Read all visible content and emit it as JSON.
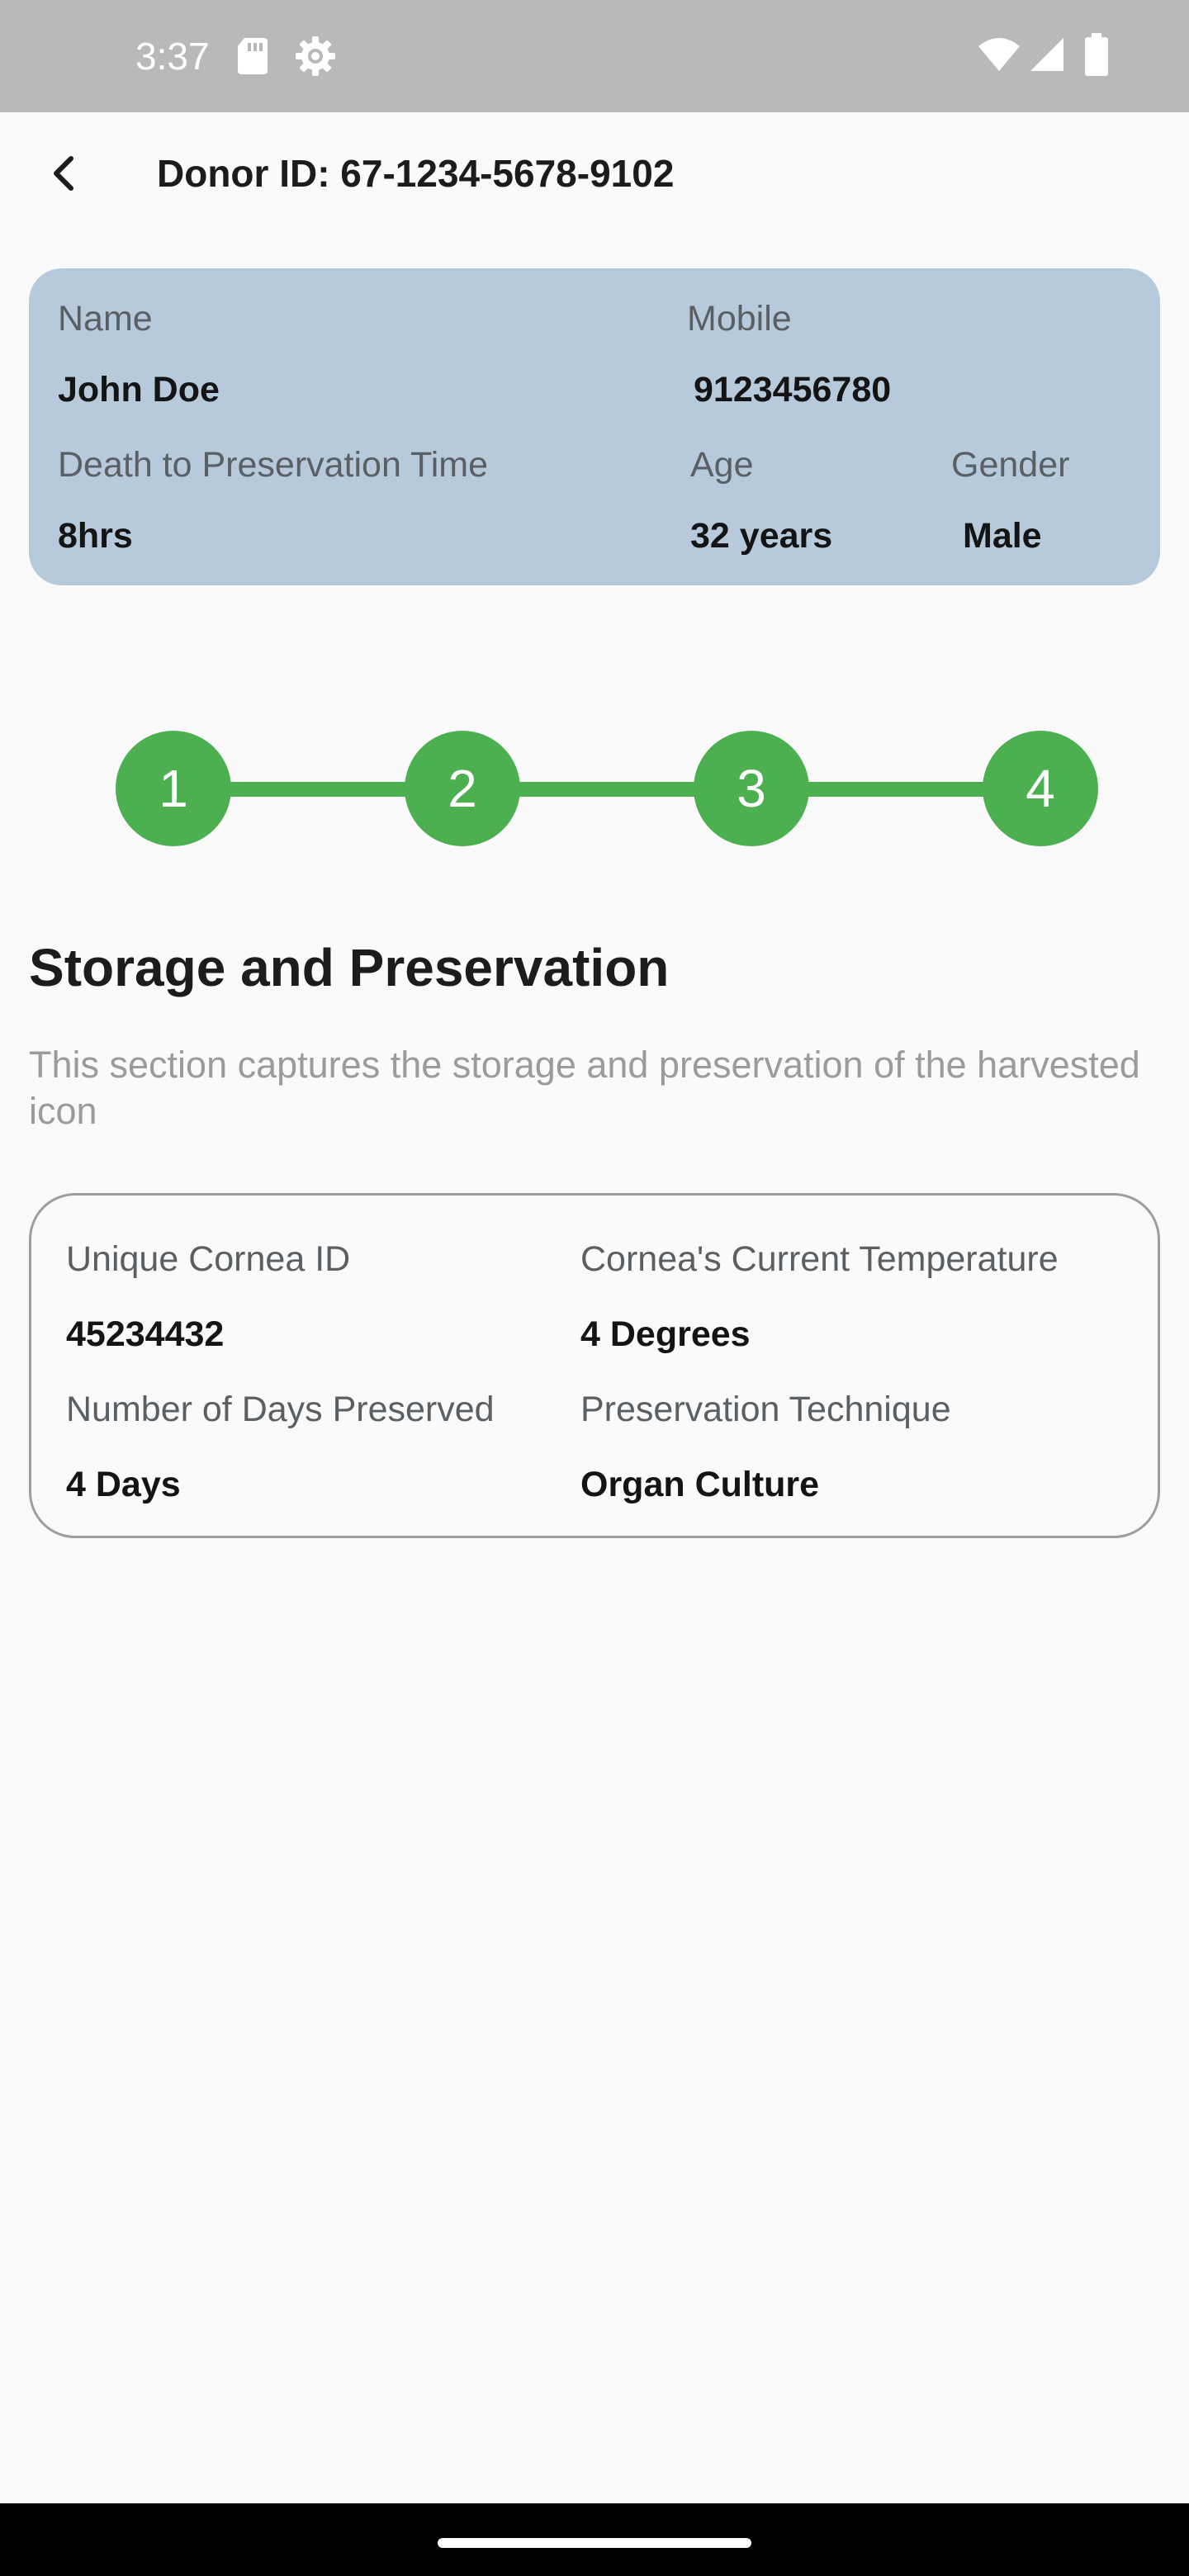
{
  "status_bar": {
    "time": "3:37",
    "icons": [
      "sd-card-icon",
      "settings-gear-icon",
      "wifi-icon",
      "signal-icon",
      "battery-icon"
    ]
  },
  "app_bar": {
    "back_icon": "chevron-left-icon",
    "title": "Donor ID: 67-1234-5678-9102"
  },
  "donor": {
    "name_label": "Name",
    "name_value": "John Doe",
    "mobile_label": "Mobile",
    "mobile_value": "9123456780",
    "dpt_label": "Death to Preservation Time",
    "dpt_value": "8hrs",
    "age_label": "Age",
    "age_value": "32 years",
    "gender_label": "Gender",
    "gender_value": "Male"
  },
  "stepper": {
    "steps": [
      "1",
      "2",
      "3",
      "4"
    ],
    "active_color": "#4caf50"
  },
  "section": {
    "title": "Storage and Preservation",
    "description": "This section captures the storage and preservation of the harvested icon"
  },
  "storage": {
    "cornea_id_label": "Unique Cornea ID",
    "cornea_id_value": "45234432",
    "temperature_label": "Cornea's Current Temperature",
    "temperature_value": "4 Degrees",
    "days_label": "Number of Days Preserved",
    "days_value": "4 Days",
    "technique_label": "Preservation Technique",
    "technique_value": "Organ Culture"
  },
  "colors": {
    "donor_card_bg": "#b7cadb",
    "status_bar_bg": "#b9b9b9",
    "step_green": "#4caf50"
  }
}
